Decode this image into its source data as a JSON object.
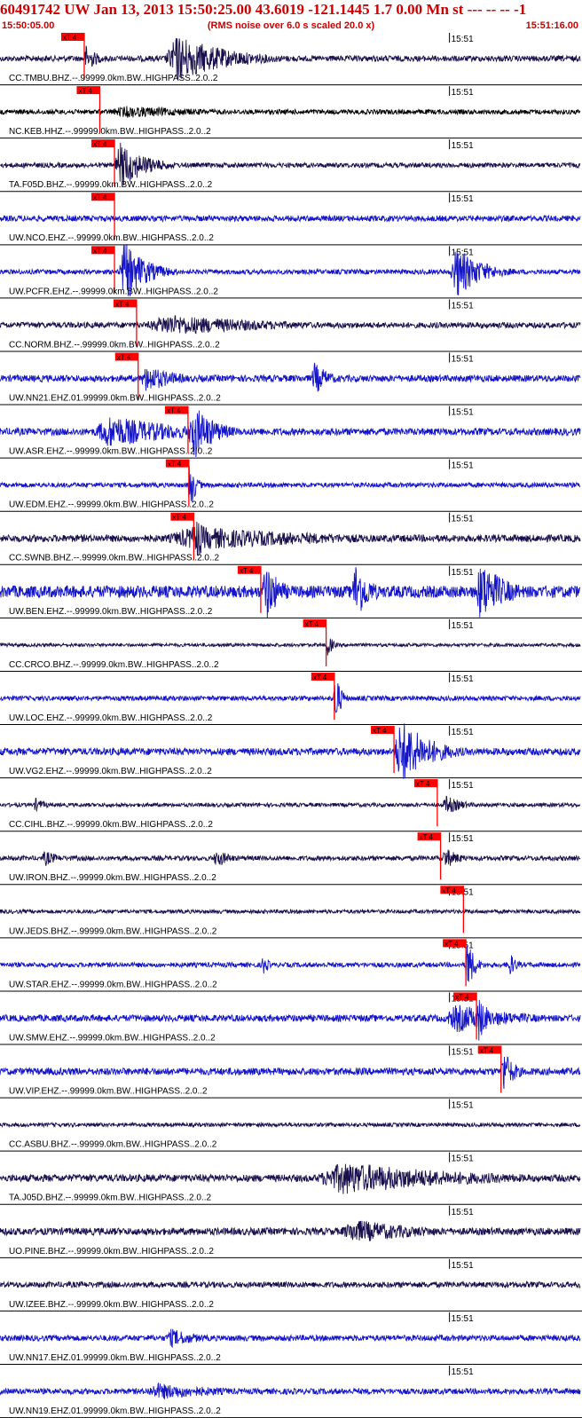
{
  "header": {
    "title": "60491742 UW Jan 13, 2013 15:50:25.00   43.6019 -121.1445  1.7 0.00 Mn st --- -- -- -1",
    "start_time": "15:50:05.00",
    "rms_note": "(RMS noise over 6.0 s scaled 20.0 x)",
    "end_time": "15:51:16.00"
  },
  "chart_data": {
    "type": "line",
    "title": "60491742 UW Jan 13, 2013 15:50:25.00   43.6019 -121.1445  1.7 0.00 Mn st --- -- -- -1",
    "x_start": "15:50:05.00",
    "x_end": "15:51:16.00",
    "x_range_seconds": [
      0,
      71
    ],
    "minute_tick_label": "15:51",
    "minute_tick_seconds": 55,
    "pick_label": "xT 4",
    "grid": false,
    "colors": {
      "header": "#cc0000",
      "pick": "#ff0000",
      "pick_label_bg": "#ff0000",
      "tick": "#000000"
    },
    "traces": [
      {
        "label": "CC.TMBU.BHZ.--.99999.0km.BW..HIGHPASS..2.0..2",
        "color": "#1a0f4d",
        "pick_s": 10.2,
        "noise": 0.12,
        "bursts": [
          {
            "t": 20,
            "dur": 14,
            "amp": 1.0
          },
          {
            "t": 10.2,
            "dur": 3,
            "amp": 0.6
          }
        ]
      },
      {
        "label": "NC.KEB.HHZ.--.99999.0km.BW..HIGHPASS..2.0..2",
        "color": "#000000",
        "pick_s": 12.1,
        "noise": 0.1,
        "bursts": [
          {
            "t": 12.1,
            "dur": 28,
            "amp": 0.25
          }
        ]
      },
      {
        "label": "TA.F05D.BHZ.--.99999.0km.BW..HIGHPASS..2.0..2",
        "color": "#1a0f4d",
        "pick_s": 13.9,
        "noise": 0.1,
        "bursts": [
          {
            "t": 13.9,
            "dur": 7,
            "amp": 1.0
          }
        ]
      },
      {
        "label": "UW.NCO.EHZ.--.99999.0km.BW..HIGHPASS..2.0..2",
        "color": "#1414c8",
        "pick_s": 13.9,
        "noise": 0.12,
        "bursts": []
      },
      {
        "label": "UW.PCFR.EHZ.--.99999.0km.BW..HIGHPASS..2.0..2",
        "color": "#1414c8",
        "pick_s": 13.9,
        "noise": 0.1,
        "bursts": [
          {
            "t": 14.5,
            "dur": 6,
            "amp": 1.3
          },
          {
            "t": 55,
            "dur": 7,
            "amp": 1.1
          }
        ]
      },
      {
        "label": "CC.NORM.BHZ.--.99999.0km.BW..HIGHPASS..2.0..2",
        "color": "#1a0f4d",
        "pick_s": 16.6,
        "noise": 0.12,
        "bursts": [
          {
            "t": 17,
            "dur": 30,
            "amp": 0.45
          }
        ]
      },
      {
        "label": "UW.NN21.EHZ.01.99999.0km.BW..HIGHPASS..2.0..2",
        "color": "#1414c8",
        "pick_s": 16.8,
        "noise": 0.14,
        "bursts": [
          {
            "t": 17,
            "dur": 8,
            "amp": 0.6
          },
          {
            "t": 38,
            "dur": 4,
            "amp": 0.7
          }
        ]
      },
      {
        "label": "UW.ASR.EHZ.--.99999.0km.BW..HIGHPASS..2.0..2",
        "color": "#1414c8",
        "pick_s": 22.9,
        "noise": 0.15,
        "bursts": [
          {
            "t": 11,
            "dur": 20,
            "amp": 0.7
          },
          {
            "t": 22.9,
            "dur": 6,
            "amp": 1.2
          }
        ]
      },
      {
        "label": "UW.EDM.EHZ.--.99999.0km.BW..HIGHPASS..2.0..2",
        "color": "#1414c8",
        "pick_s": 23.0,
        "noise": 0.1,
        "bursts": [
          {
            "t": 23.0,
            "dur": 1.5,
            "amp": 1.3
          }
        ]
      },
      {
        "label": "CC.SWNB.BHZ.--.99999.0km.BW..HIGHPASS..2.0..2",
        "color": "#1a0f4d",
        "pick_s": 23.6,
        "noise": 0.15,
        "bursts": [
          {
            "t": 19,
            "dur": 40,
            "amp": 0.5
          },
          {
            "t": 23.6,
            "dur": 3,
            "amp": 1.0
          }
        ]
      },
      {
        "label": "UW.BEN.EHZ.--.99999.0km.BW..HIGHPASS..2.0..2",
        "color": "#1414c8",
        "pick_s": 31.8,
        "noise": 0.25,
        "bursts": [
          {
            "t": 32,
            "dur": 4,
            "amp": 1.3
          },
          {
            "t": 43,
            "dur": 4,
            "amp": 1.3
          },
          {
            "t": 58,
            "dur": 7,
            "amp": 1.3
          }
        ]
      },
      {
        "label": "CC.CRCO.BHZ.--.99999.0km.BW..HIGHPASS..2.0..2",
        "color": "#1a0f4d",
        "pick_s": 39.8,
        "noise": 0.07,
        "bursts": [
          {
            "t": 39.8,
            "dur": 1.5,
            "amp": 0.6
          }
        ]
      },
      {
        "label": "UW.LOC.EHZ.--.99999.0km.BW..HIGHPASS..2.0..2",
        "color": "#1414c8",
        "pick_s": 40.8,
        "noise": 0.1,
        "bursts": [
          {
            "t": 40.8,
            "dur": 1.5,
            "amp": 1.3
          }
        ]
      },
      {
        "label": "UW.VG2.EHZ.--.99999.0km.BW..HIGHPASS..2.0..2",
        "color": "#1414c8",
        "pick_s": 48.1,
        "noise": 0.15,
        "bursts": [
          {
            "t": 48.1,
            "dur": 8,
            "amp": 1.4
          }
        ]
      },
      {
        "label": "CC.CIHL.BHZ.--.99999.0km.BW..HIGHPASS..2.0..2",
        "color": "#1a0f4d",
        "pick_s": 53.4,
        "noise": 0.08,
        "bursts": [
          {
            "t": 4,
            "dur": 3,
            "amp": 0.3
          },
          {
            "t": 54,
            "dur": 5,
            "amp": 0.4
          }
        ]
      },
      {
        "label": "UW.IRON.BHZ.--.99999.0km.BW..HIGHPASS..2.0..2",
        "color": "#1a0f4d",
        "pick_s": 53.8,
        "noise": 0.1,
        "bursts": [
          {
            "t": 5,
            "dur": 4,
            "amp": 0.35
          },
          {
            "t": 26,
            "dur": 4,
            "amp": 0.4
          },
          {
            "t": 54,
            "dur": 4,
            "amp": 0.45
          }
        ]
      },
      {
        "label": "UW.JEDS.BHZ.--.99999.0km.BW..HIGHPASS..2.0..2",
        "color": "#1a0f4d",
        "pick_s": 56.6,
        "noise": 0.08,
        "bursts": []
      },
      {
        "label": "UW.STAR.EHZ.--.99999.0km.BW..HIGHPASS..2.0..2",
        "color": "#1414c8",
        "pick_s": 56.9,
        "noise": 0.1,
        "bursts": [
          {
            "t": 32,
            "dur": 1.5,
            "amp": 0.5
          },
          {
            "t": 56.9,
            "dur": 2,
            "amp": 1.2
          },
          {
            "t": 62,
            "dur": 2,
            "amp": 0.6
          }
        ]
      },
      {
        "label": "UW.SMW.EHZ.--.99999.0km.BW..HIGHPASS..2.0..2",
        "color": "#1414c8",
        "pick_s": 58.2,
        "noise": 0.14,
        "bursts": [
          {
            "t": 54,
            "dur": 16,
            "amp": 0.6
          },
          {
            "t": 58.2,
            "dur": 3,
            "amp": 1.0
          }
        ]
      },
      {
        "label": "UW.VIP.EHZ.--.99999.0km.BW..HIGHPASS..2.0..2",
        "color": "#1414c8",
        "pick_s": 61.2,
        "noise": 0.15,
        "bursts": [
          {
            "t": 61.2,
            "dur": 3,
            "amp": 1.0
          }
        ]
      },
      {
        "label": "CC.ASBU.BHZ.--.99999.0km.BW..HIGHPASS..2.0..2",
        "color": "#1a0f4d",
        "pick_s": null,
        "noise": 0.08,
        "bursts": []
      },
      {
        "label": "TA.J05D.BHZ.--.99999.0km.BW..HIGHPASS..2.0..2",
        "color": "#1a0f4d",
        "pick_s": null,
        "noise": 0.15,
        "bursts": [
          {
            "t": 38,
            "dur": 33,
            "amp": 0.7
          }
        ]
      },
      {
        "label": "UO.PINE.BHZ.--.99999.0km.BW..HIGHPASS..2.0..2",
        "color": "#1a0f4d",
        "pick_s": null,
        "noise": 0.15,
        "bursts": [
          {
            "t": 41,
            "dur": 20,
            "amp": 0.5
          }
        ]
      },
      {
        "label": "UW.IZEE.BHZ.--.99999.0km.BW..HIGHPASS..2.0..2",
        "color": "#1a0f4d",
        "pick_s": null,
        "noise": 0.12,
        "bursts": []
      },
      {
        "label": "UW.NN17.EHZ.01.99999.0km.BW..HIGHPASS..2.0..2",
        "color": "#1414c8",
        "pick_s": null,
        "noise": 0.12,
        "bursts": [
          {
            "t": 20,
            "dur": 8,
            "amp": 0.4
          }
        ]
      },
      {
        "label": "UW.NN19.EHZ.01.99999.0km.BW..HIGHPASS..2.0..2",
        "color": "#1414c8",
        "pick_s": null,
        "noise": 0.12,
        "bursts": [
          {
            "t": 17,
            "dur": 20,
            "amp": 0.35
          }
        ]
      }
    ]
  }
}
